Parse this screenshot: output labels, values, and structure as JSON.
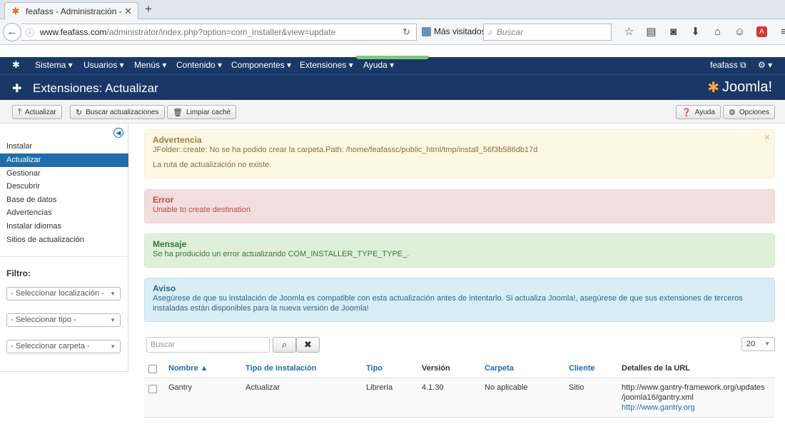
{
  "browser": {
    "tab_title": "feafass - Administración - ...",
    "url_domain": "www.feafass.com",
    "url_path": "/administrator/index.php?option=com_installer&view=update",
    "bookmarks_label": "Más visitados",
    "search_placeholder": "Buscar"
  },
  "menu": {
    "items": [
      "Sistema ▾",
      "Usuarios ▾",
      "Menús ▾",
      "Contenido ▾",
      "Componentes ▾",
      "Extensiones ▾",
      "Ayuda ▾"
    ],
    "user": "feafass ⧉",
    "gear": "⚙ ▾"
  },
  "header": {
    "title": "Extensiones: Actualizar",
    "logo_text": "Joomla!"
  },
  "toolbar": {
    "update": "Actualizar",
    "find_updates": "Buscar actualizaciones",
    "purge_cache": "Limpiar caché",
    "help": "Ayuda",
    "options": "Opciones"
  },
  "sidebar": {
    "items": [
      "Instalar",
      "Actualizar",
      "Gestionar",
      "Descubrir",
      "Base de datos",
      "Advertencias",
      "Instalar idiomas",
      "Sitios de actualización"
    ],
    "filter_title": "Filtro:",
    "filters": [
      "- Seleccionar localización -",
      "- Seleccionar tipo -",
      "- Seleccionar carpeta -"
    ]
  },
  "alerts": {
    "warning": {
      "heading": "Advertencia",
      "line1": "JFolder::create: No se ha podido crear la carpeta.Path: /home/feafassc/public_html/tmp/install_56f3b586db17d",
      "line2": "La ruta de actualización no existe."
    },
    "error": {
      "heading": "Error",
      "line1": "Unable to create destination"
    },
    "message": {
      "heading": "Mensaje",
      "line1": "Se ha producido un error actualizando COM_INSTALLER_TYPE_TYPE_."
    },
    "notice": {
      "heading": "Aviso",
      "line1": "Asegúrese de que su instalación de Joomla es compatible con esta actualización antes de intentarlo. Si actualiza Joomla!, asegúrese de que sus extensiones de terceros",
      "line2": "instaladas están disponibles para la nueva versión de Joomla!"
    }
  },
  "list": {
    "search_placeholder": "Buscar",
    "limit": "20",
    "headers": {
      "name": "Nombre ▲",
      "install_type": "Tipo de instalación",
      "type": "Tipo",
      "version": "Versión",
      "folder": "Carpeta",
      "client": "Cliente",
      "url_details": "Detalles de la URL"
    },
    "rows": [
      {
        "name": "Gantry",
        "install_type": "Actualizar",
        "type": "Librería",
        "version": "4.1.30",
        "folder": "No aplicable",
        "client": "Sitio",
        "url1": "http://www.gantry-framework.org/updates",
        "url2": "/joomla16/gantry.xml",
        "url3": "http://www.gantry.org"
      }
    ]
  }
}
